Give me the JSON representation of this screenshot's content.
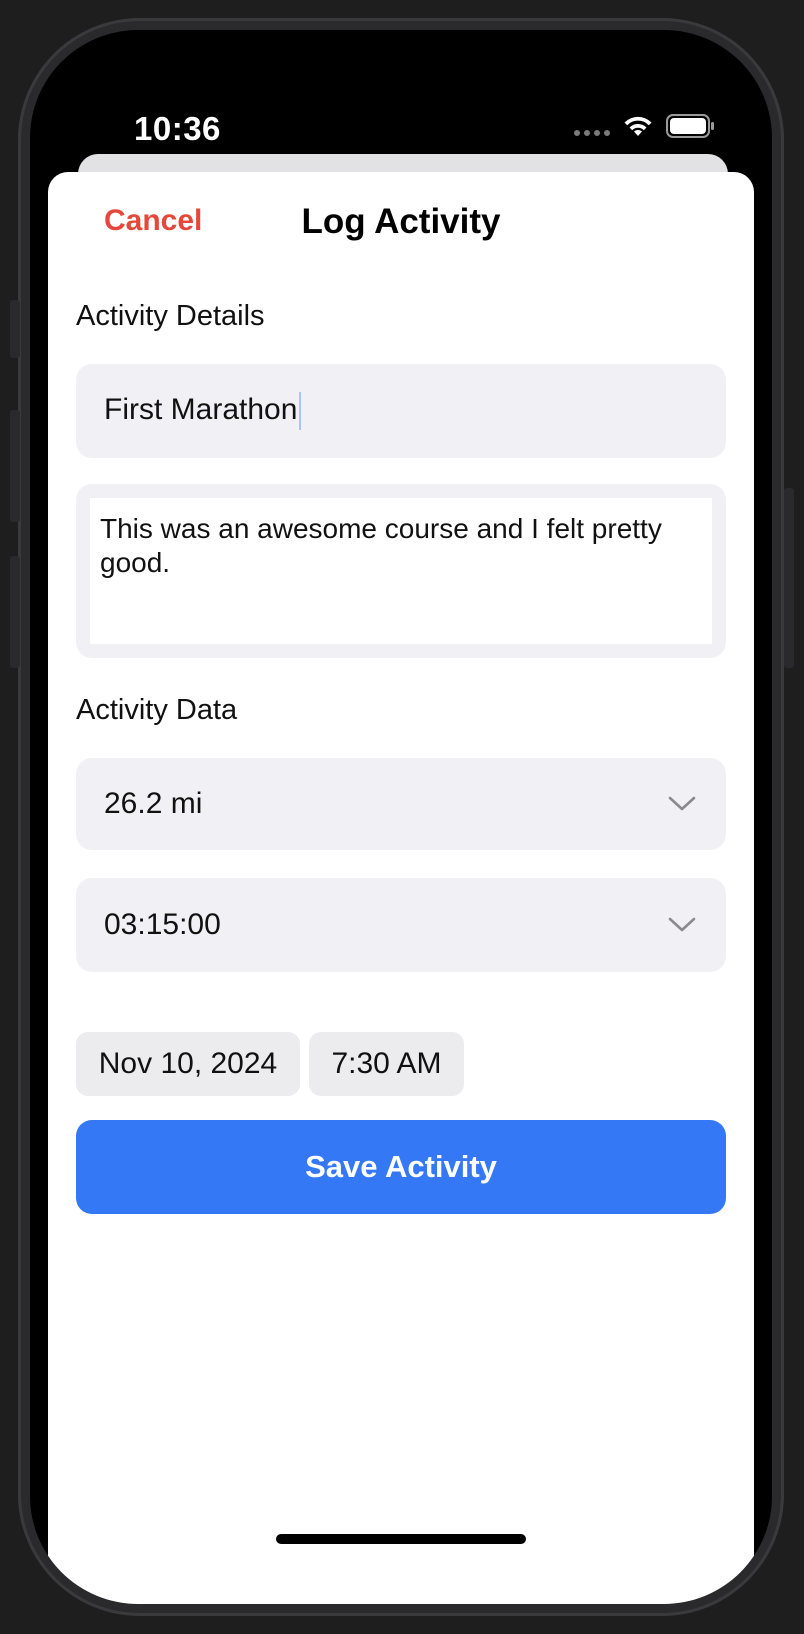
{
  "status_bar": {
    "time": "10:36"
  },
  "nav": {
    "cancel_label": "Cancel",
    "title": "Log Activity"
  },
  "details": {
    "section_label": "Activity Details",
    "name_value": "First Marathon",
    "notes_value": "This was an awesome course and I felt pretty good."
  },
  "data_section": {
    "section_label": "Activity Data",
    "distance_value": "26.2 mi",
    "duration_value": "03:15:00",
    "date_value": "Nov 10, 2024",
    "time_value": "7:30 AM"
  },
  "save_label": "Save Activity",
  "colors": {
    "accent_blue": "#3478f6",
    "cancel_red": "#e5483b",
    "field_bg": "#f1f1f5"
  },
  "icons": {
    "dropdown": "chevron-down-icon",
    "wifi": "wifi-icon",
    "battery": "battery-icon",
    "signal": "signal-icon"
  }
}
